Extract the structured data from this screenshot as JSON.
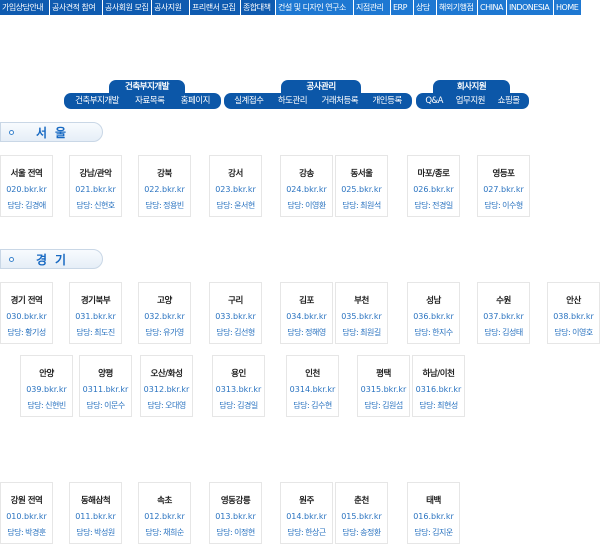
{
  "topnav": [
    {
      "label": "가입상담안내"
    },
    {
      "label": "공사견적 참여"
    },
    {
      "label": "공사회원 모집"
    },
    {
      "label": "공사지원"
    },
    {
      "label": "프리랜서 모집"
    },
    {
      "label": "종합대책"
    },
    {
      "label": "건설 및 디자인 연구소"
    },
    {
      "label": "지점관리"
    },
    {
      "label": "ERP"
    },
    {
      "label": "상담"
    },
    {
      "label": "해외기행점"
    },
    {
      "label": "CHINA"
    },
    {
      "label": "INDONESIA"
    },
    {
      "label": "HOME"
    }
  ],
  "menu_groups": [
    {
      "title": "건축부지개발",
      "items": [
        "건축부지개발",
        "자료목록",
        "홈페이지"
      ]
    },
    {
      "title": "공사관리",
      "items": [
        "실계접수",
        "하도관리",
        "거래처등록",
        "개인등록"
      ]
    },
    {
      "title": "회사지원",
      "items": [
        "Q&A",
        "업무지원",
        "쇼핑몰"
      ]
    }
  ],
  "regions": [
    {
      "name": "서울",
      "cards": [
        {
          "name": "서울 전역",
          "url": "020.bkr.kr",
          "manager": "담당: 김경애"
        },
        {
          "name": "강남/관악",
          "url": "021.bkr.kr",
          "manager": "담당: 신현호"
        },
        {
          "name": "강북",
          "url": "022.bkr.kr",
          "manager": "담당: 정용빈"
        },
        {
          "name": "강서",
          "url": "023.bkr.kr",
          "manager": "담당: 윤서현"
        },
        {
          "name": "강송",
          "url": "024.bkr.kr",
          "manager": "담당: 이영환"
        },
        {
          "name": "동서울",
          "url": "025.bkr.kr",
          "manager": "담당: 최원석"
        },
        {
          "name": "마포/종로",
          "url": "026.bkr.kr",
          "manager": "담당: 전경일"
        },
        {
          "name": "영등포",
          "url": "027.bkr.kr",
          "manager": "담당: 이수형"
        }
      ]
    },
    {
      "name": "경기",
      "cards": [
        {
          "name": "경기 전역",
          "url": "030.bkr.kr",
          "manager": "담당: 황기성"
        },
        {
          "name": "경기북부",
          "url": "031.bkr.kr",
          "manager": "담당: 최도진"
        },
        {
          "name": "고양",
          "url": "032.bkr.kr",
          "manager": "담당: 유가영"
        },
        {
          "name": "구리",
          "url": "033.bkr.kr",
          "manager": "담당: 김선형"
        },
        {
          "name": "김포",
          "url": "034.bkr.kr",
          "manager": "담당: 정해영"
        },
        {
          "name": "부천",
          "url": "035.bkr.kr",
          "manager": "담당: 최원길"
        },
        {
          "name": "성남",
          "url": "036.bkr.kr",
          "manager": "담당: 한지수"
        },
        {
          "name": "수원",
          "url": "037.bkr.kr",
          "manager": "담당: 김성태"
        },
        {
          "name": "안산",
          "url": "038.bkr.kr",
          "manager": "담당: 이영호"
        },
        {
          "name": "안양",
          "url": "039.bkr.kr",
          "manager": "담당: 신현빈"
        },
        {
          "name": "양평",
          "url": "0311.bkr.kr",
          "manager": "담당: 이문수"
        },
        {
          "name": "오산/화성",
          "url": "0312.bkr.kr",
          "manager": "담당: 오대영"
        },
        {
          "name": "용인",
          "url": "0313.bkr.kr",
          "manager": "담당: 김경일"
        },
        {
          "name": "인천",
          "url": "0314.bkr.kr",
          "manager": "담당: 김수현"
        },
        {
          "name": "평택",
          "url": "0315.bkr.kr",
          "manager": "담당: 김원섭"
        },
        {
          "name": "하남/이천",
          "url": "0316.bkr.kr",
          "manager": "담당: 최현성"
        }
      ]
    },
    {
      "name": "",
      "cards": [
        {
          "name": "강원 전역",
          "url": "010.bkr.kr",
          "manager": "담당: 박경훈"
        },
        {
          "name": "동해삼척",
          "url": "011.bkr.kr",
          "manager": "담당: 박성원"
        },
        {
          "name": "속초",
          "url": "012.bkr.kr",
          "manager": "담당: 채희순"
        },
        {
          "name": "영동강릉",
          "url": "013.bkr.kr",
          "manager": "담당: 이정현"
        },
        {
          "name": "원주",
          "url": "014.bkr.kr",
          "manager": "담당: 한상근"
        },
        {
          "name": "춘천",
          "url": "015.bkr.kr",
          "manager": "담당: 송정환"
        },
        {
          "name": "태백",
          "url": "016.bkr.kr",
          "manager": "담당: 김지운"
        }
      ]
    }
  ]
}
